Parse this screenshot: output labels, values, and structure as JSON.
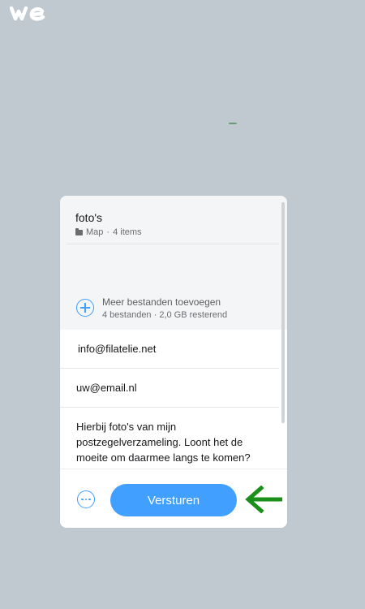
{
  "brand": {
    "logo_icon": "wetransfer-logo-icon"
  },
  "transfer": {
    "file": {
      "name": "foto's",
      "type_label": "Map",
      "separator": "·",
      "count_label": "4 items"
    },
    "add_files": {
      "label": "Meer bestanden toevoegen",
      "summary": "4 bestanden · 2,0 GB resterend"
    },
    "email_to": "info@filatelie.net",
    "email_from": "uw@email.nl",
    "message": "Hierbij foto's van mijn postzegelverzameling. Loont het de moeite om daarmee langs te komen?"
  },
  "footer": {
    "send_label": "Versturen",
    "more_icon": "more-options-icon"
  },
  "annotation": {
    "arrow_icon": "left-arrow-icon",
    "color": "#1a8f1a"
  },
  "colors": {
    "accent": "#409fff",
    "background": "#c0c9d0"
  }
}
